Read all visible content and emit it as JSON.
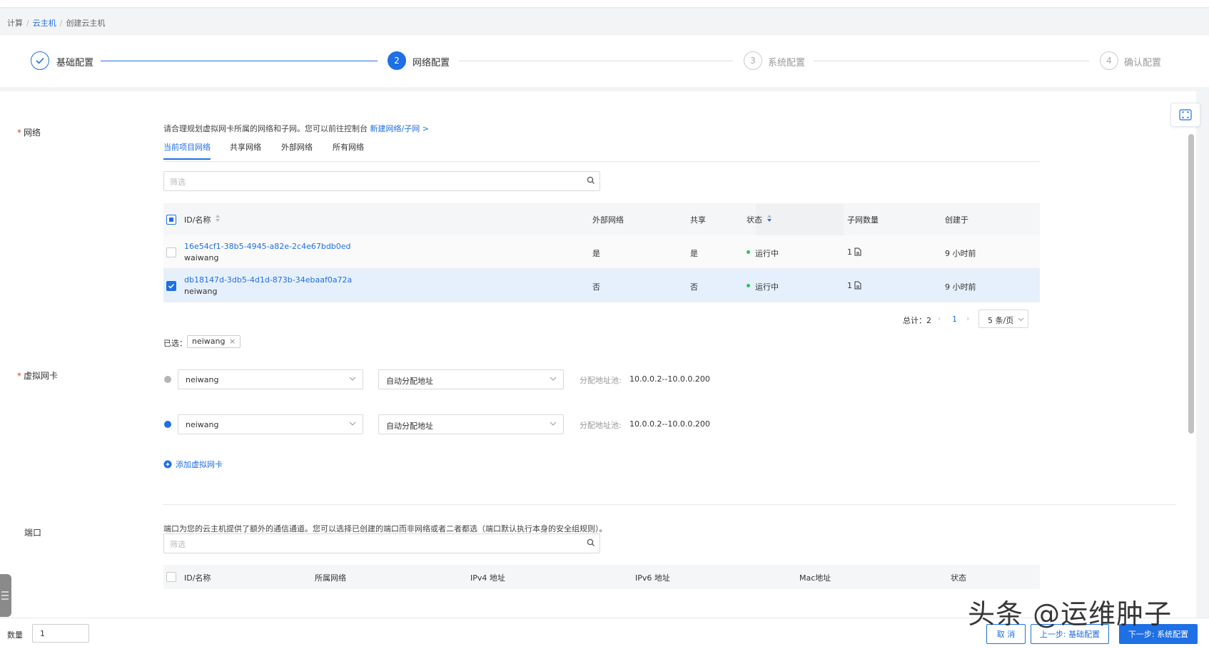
{
  "breadcrumb": {
    "compute": "计算",
    "ecs": "云主机",
    "current": "创建云主机"
  },
  "steps": {
    "s1": {
      "label": "基础配置"
    },
    "s2": {
      "num": "2",
      "label": "网络配置"
    },
    "s3": {
      "num": "3",
      "label": "系统配置"
    },
    "s4": {
      "num": "4",
      "label": "确认配置"
    }
  },
  "network": {
    "label": "网络",
    "hint_text": "请合理规划虚拟网卡所属的网络和子网。您可以前往控制台",
    "hint_link": "新建网络/子网 >",
    "tabs": [
      "当前项目网络",
      "共享网络",
      "外部网络",
      "所有网络"
    ],
    "search_placeholder": "筛选",
    "columns": {
      "id": "ID/名称",
      "external": "外部网络",
      "shared": "共享",
      "status": "状态",
      "subnets": "子网数量",
      "created": "创建于"
    },
    "rows": [
      {
        "id": "16e54cf1-38b5-4945-a82e-2c4e67bdb0ed",
        "name": "waiwang",
        "external": "是",
        "shared": "是",
        "status": "运行中",
        "subnets": "1",
        "created": "9 小时前",
        "checked": false
      },
      {
        "id": "db18147d-3db5-4d1d-873b-34ebaaf0a72a",
        "name": "neiwang",
        "external": "否",
        "shared": "否",
        "status": "运行中",
        "subnets": "1",
        "created": "9 小时前",
        "checked": true
      }
    ],
    "pagination": {
      "total_label": "总计：",
      "total": "2",
      "page": "1",
      "page_size": "5 条/页"
    },
    "selected_label": "已选：",
    "selected_tag": "neiwang"
  },
  "nic": {
    "label": "虚拟网卡",
    "items": [
      {
        "network": "neiwang",
        "mode": "自动分配地址",
        "pool_label": "分配地址池:",
        "pool": "10.0.0.2--10.0.0.200",
        "dot": "#b5b5b5"
      },
      {
        "network": "neiwang",
        "mode": "自动分配地址",
        "pool_label": "分配地址池:",
        "pool": "10.0.0.2--10.0.0.200",
        "dot": "#1f6fe5"
      }
    ],
    "add_label": "添加虚拟网卡"
  },
  "port": {
    "label": "端口",
    "hint": "端口为您的云主机提供了额外的通信通道。您可以选择已创建的端口而非网络或者二者都选（端口默认执行本身的安全组规则）。",
    "search_placeholder": "筛选",
    "columns": {
      "id": "ID/名称",
      "network": "所属网络",
      "ipv4": "IPv4 地址",
      "ipv6": "IPv6 地址",
      "mac": "Mac地址",
      "status": "状态"
    }
  },
  "footer": {
    "qty_label": "数量",
    "qty_value": "1",
    "cancel": "取 消",
    "prev": "上一步: 基础配置",
    "next": "下一步: 系统配置"
  },
  "watermark": "头条 @运维肿子",
  "colors": {
    "primary": "#1f6fe5",
    "running": "#2fc25b",
    "required": "#e33333"
  }
}
